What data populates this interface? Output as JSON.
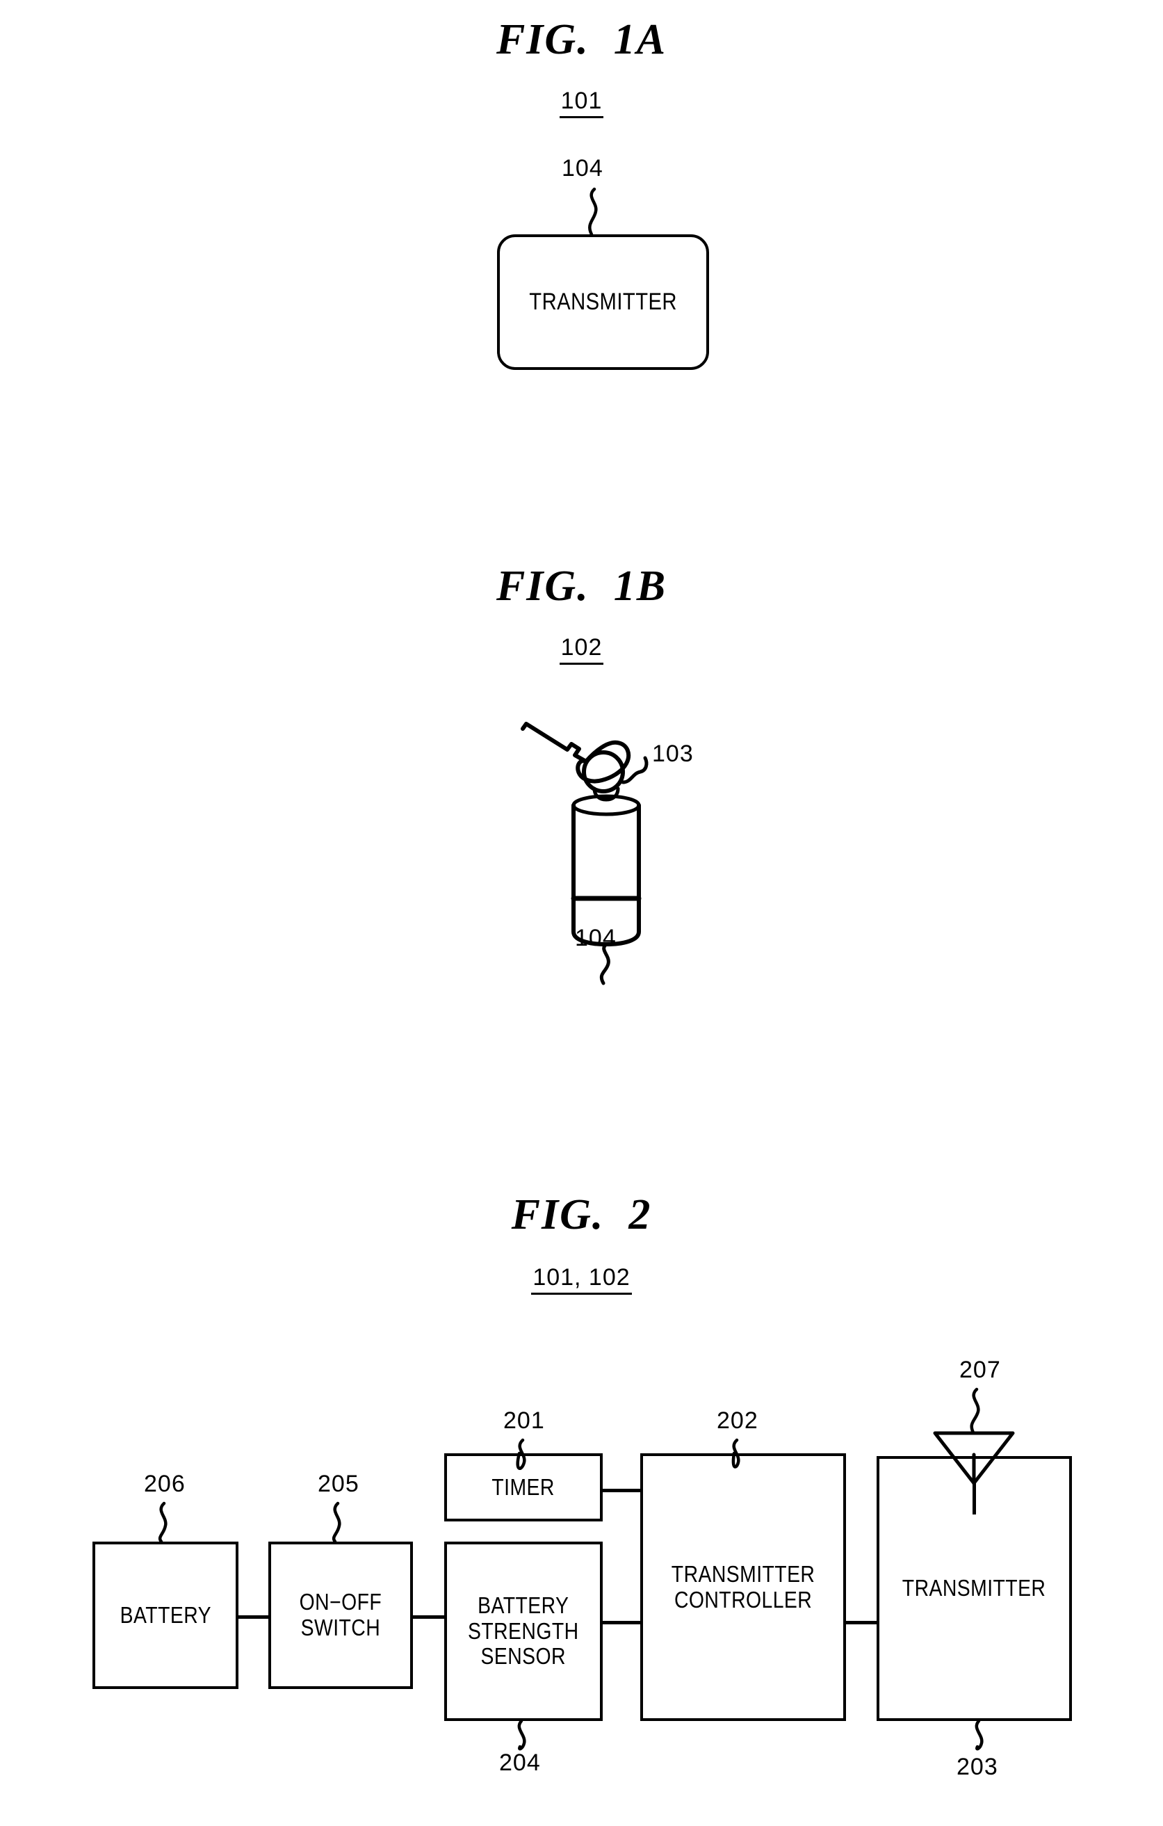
{
  "document": {
    "type": "patent-drawing-sheet",
    "background_color": "#ffffff",
    "ink_color": "#000000"
  },
  "figures": [
    {
      "id": "fig-1a",
      "title": "FIG.  1A",
      "reference": "101",
      "blocks": [
        {
          "id": "transmitter-1a",
          "label": "TRANSMITTER",
          "reference": "104",
          "shape": "rounded-rectangle"
        }
      ]
    },
    {
      "id": "fig-1b",
      "title": "FIG.  1B",
      "reference": "102",
      "callouts": [
        {
          "reference": "103",
          "target": "key-ring"
        },
        {
          "reference": "104",
          "target": "cylindrical-fob-body"
        }
      ]
    },
    {
      "id": "fig-2",
      "title": "FIG.  2",
      "reference": "101, 102",
      "blocks": [
        {
          "id": "battery",
          "label": "BATTERY",
          "reference": "206",
          "ref_position": "above"
        },
        {
          "id": "on-off-switch",
          "label": "ON−OFF\nSWITCH",
          "reference": "205",
          "ref_position": "above"
        },
        {
          "id": "timer",
          "label": "TIMER",
          "reference": "201",
          "ref_position": "above"
        },
        {
          "id": "battery-strength",
          "label": "BATTERY\nSTRENGTH\nSENSOR",
          "reference": "204",
          "ref_position": "below"
        },
        {
          "id": "transmitter-controller",
          "label": "TRANSMITTER\nCONTROLLER",
          "reference": "202",
          "ref_position": "above"
        },
        {
          "id": "transmitter",
          "label": "TRANSMITTER",
          "reference": "203",
          "ref_position": "below"
        }
      ],
      "antenna": {
        "id": "antenna",
        "reference": "207",
        "symbol": "inverted-triangle"
      },
      "connections": [
        {
          "from": "battery",
          "to": "on-off-switch"
        },
        {
          "from": "on-off-switch",
          "to": "battery-strength"
        },
        {
          "from": "timer",
          "to": "transmitter-controller"
        },
        {
          "from": "battery-strength",
          "to": "transmitter-controller"
        },
        {
          "from": "transmitter-controller",
          "to": "transmitter"
        },
        {
          "from": "antenna",
          "to": "transmitter"
        }
      ]
    }
  ],
  "fig1a": {
    "title": "FIG.  1A",
    "ref": "101",
    "box_label": "TRANSMITTER",
    "box_ref": "104"
  },
  "fig1b": {
    "title": "FIG.  1B",
    "ref": "102",
    "ref_103": "103",
    "ref_104": "104"
  },
  "fig2": {
    "title": "FIG.  2",
    "ref": "101, 102",
    "ref_201": "201",
    "ref_202": "202",
    "ref_203": "203",
    "ref_204": "204",
    "ref_205": "205",
    "ref_206": "206",
    "ref_207": "207",
    "label_battery": "BATTERY",
    "label_switch": "ON−OFF\nSWITCH",
    "label_timer": "TIMER",
    "label_sensor": "BATTERY\nSTRENGTH\nSENSOR",
    "label_controller": "TRANSMITTER\nCONTROLLER",
    "label_transmitter": "TRANSMITTER"
  }
}
